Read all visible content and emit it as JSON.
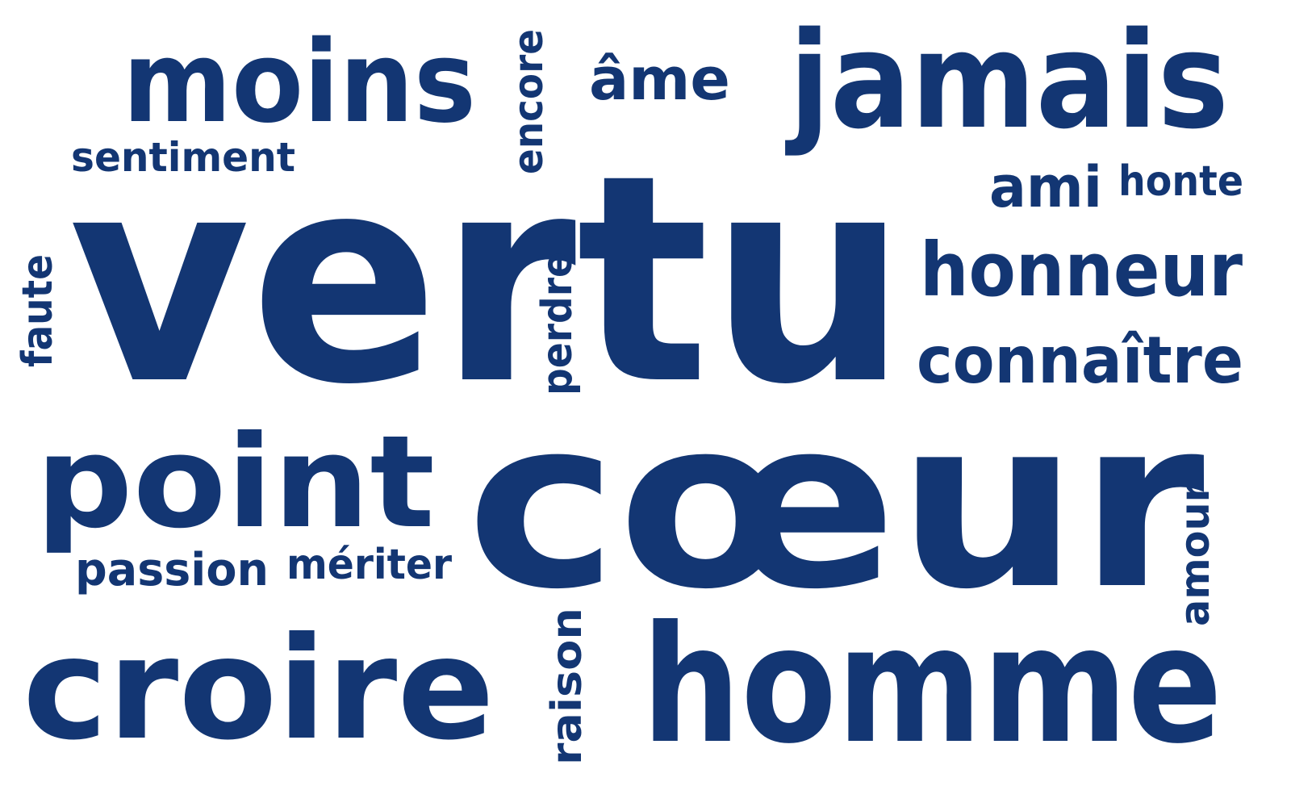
{
  "cloud": {
    "color": "#133673",
    "words": {
      "vertu": "vertu",
      "coeur": "cœur",
      "homme": "homme",
      "jamais": "jamais",
      "moins": "moins",
      "croire": "croire",
      "point": "point",
      "honneur": "honneur",
      "connaitre": "connaître",
      "ame": "âme",
      "ami": "ami",
      "honte": "honte",
      "sentiment": "sentiment",
      "encore": "encore",
      "faute": "faute",
      "perdre": "perdre",
      "passion": "passion",
      "meriter": "mériter",
      "raison": "raison",
      "amour": "amour"
    }
  }
}
